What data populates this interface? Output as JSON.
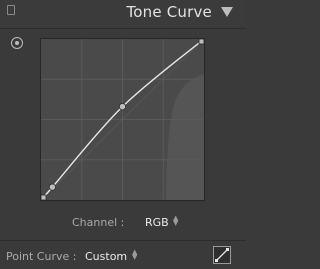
{
  "header": {
    "title": "Tone Curve",
    "panel_toggle_icon": "panel-switch-icon",
    "collapse_icon": "triangle-down-icon"
  },
  "tools": {
    "targeted_adjustment_icon": "target-adjustment-icon"
  },
  "curve": {
    "points": [
      [
        0,
        0
      ],
      [
        0.07,
        0.08
      ],
      [
        0.5,
        0.58
      ],
      [
        1,
        1
      ]
    ],
    "line_color": "#e8e8e8",
    "grid_color": "#5a5a5a",
    "background_color": "#4a4a4a",
    "histogram_color": "#555555"
  },
  "channel": {
    "label": "Channel :",
    "value": "RGB"
  },
  "point_curve": {
    "label": "Point Curve :",
    "value": "Custom",
    "edit_icon": "edit-point-curve-icon"
  }
}
